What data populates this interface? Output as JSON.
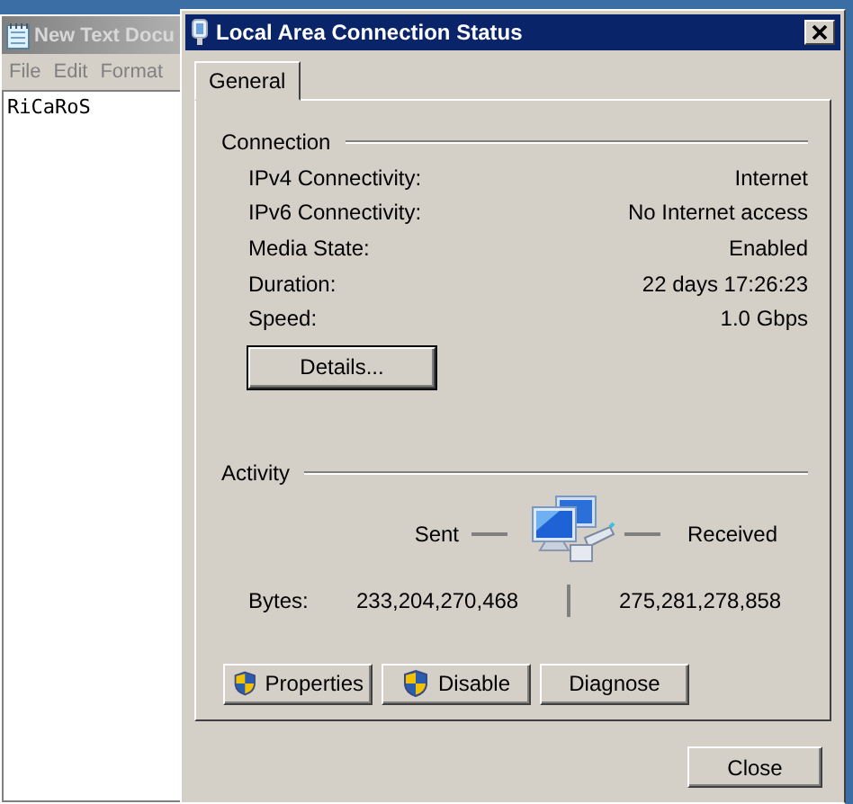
{
  "notepad": {
    "title": "New Text Docu",
    "menu": [
      "File",
      "Edit",
      "Format"
    ],
    "text": "RiCaRoS"
  },
  "dialog": {
    "title": "Local Area Connection Status",
    "tabs": [
      {
        "label": "General",
        "selected": true
      }
    ],
    "connection": {
      "heading": "Connection",
      "rows": [
        {
          "label": "IPv4 Connectivity:",
          "value": "Internet"
        },
        {
          "label": "IPv6 Connectivity:",
          "value": "No Internet access"
        },
        {
          "label": "Media State:",
          "value": "Enabled"
        },
        {
          "label": "Duration:",
          "value": "22 days 17:26:23"
        },
        {
          "label": "Speed:",
          "value": "1.0 Gbps"
        }
      ],
      "details_button": "Details..."
    },
    "activity": {
      "heading": "Activity",
      "sent_label": "Sent",
      "received_label": "Received",
      "bytes_label": "Bytes:",
      "bytes_sent": "233,204,270,468",
      "bytes_received": "275,281,278,858"
    },
    "buttons": [
      {
        "label": "Properties",
        "shield": true
      },
      {
        "label": "Disable",
        "shield": true
      },
      {
        "label": "Diagnose",
        "shield": false
      }
    ],
    "close_button": "Close"
  }
}
